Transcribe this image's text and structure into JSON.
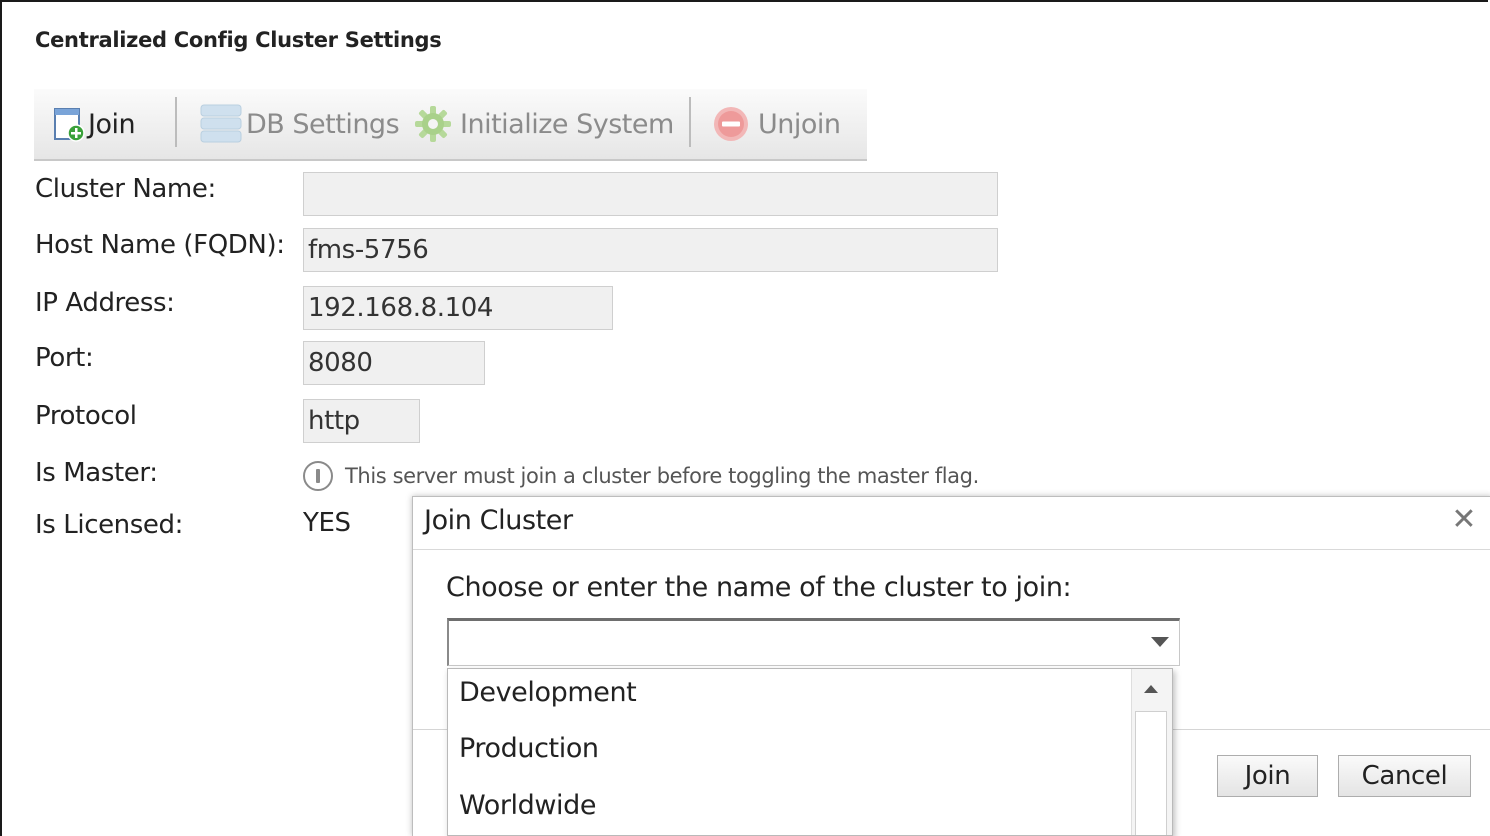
{
  "page": {
    "title": "Centralized Config Cluster Settings"
  },
  "toolbar": {
    "join_label": "Join",
    "db_settings_label": "DB Settings",
    "initialize_label": "Initialize System",
    "unjoin_label": "Unjoin",
    "icons": [
      "join-icon",
      "database-icon",
      "gear-icon",
      "unjoin-icon"
    ]
  },
  "form": {
    "cluster_name": {
      "label": "Cluster Name:",
      "value": ""
    },
    "host_name": {
      "label": "Host Name (FQDN):",
      "value": "fms-5756"
    },
    "ip_address": {
      "label": "IP Address:",
      "value": "192.168.8.104"
    },
    "port": {
      "label": "Port:",
      "value": "8080"
    },
    "protocol": {
      "label": "Protocol",
      "value": "http"
    },
    "is_master": {
      "label": "Is Master:",
      "info": "This server must join a cluster before toggling the master flag."
    },
    "is_licensed": {
      "label": "Is Licensed:",
      "value": "YES"
    }
  },
  "dialog": {
    "title": "Join Cluster",
    "close_glyph": "✕",
    "prompt": "Choose or enter the name of the cluster to join:",
    "combo_value": "",
    "options": [
      "Development",
      "Production",
      "Worldwide"
    ],
    "join_button": "Join",
    "cancel_button": "Cancel"
  },
  "colors": {
    "join_icon_green": "#3aa13a",
    "unjoin_icon_red": "#e24a4a",
    "field_bg": "#f0f0f0"
  }
}
